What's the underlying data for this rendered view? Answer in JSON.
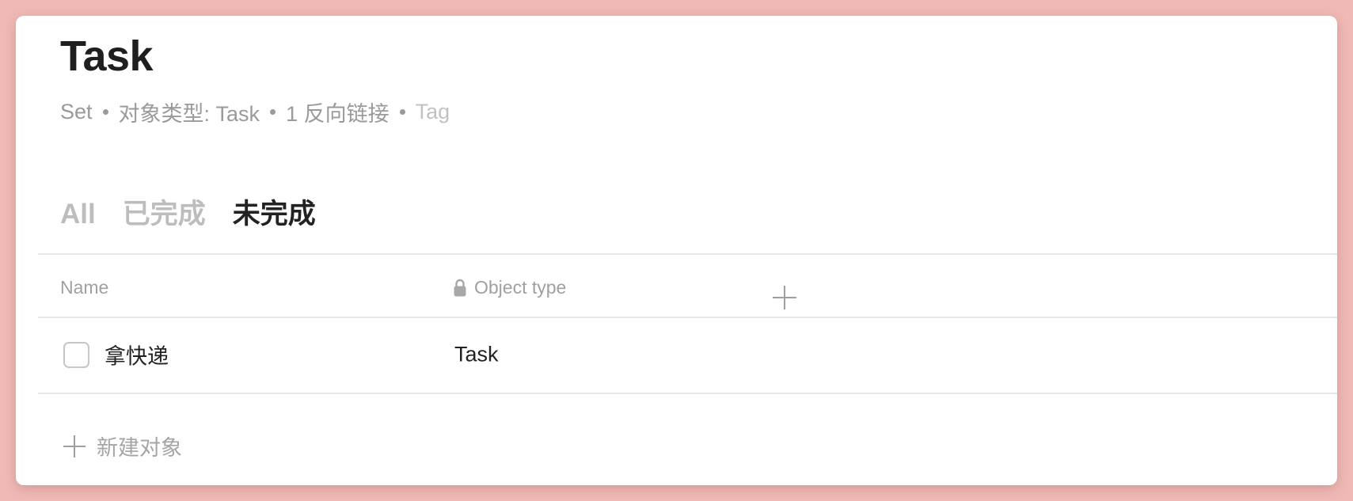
{
  "page": {
    "title": "Task",
    "meta": {
      "set": "Set",
      "object_type": "对象类型: Task",
      "backlinks": "1 反向链接",
      "tag": "Tag"
    }
  },
  "tabs": [
    {
      "label": "All",
      "active": false
    },
    {
      "label": "已完成",
      "active": false
    },
    {
      "label": "未完成",
      "active": true
    }
  ],
  "table": {
    "columns": [
      "Name",
      "Object type"
    ],
    "rows": [
      {
        "name": "拿快递",
        "object_type": "Task",
        "checked": false
      }
    ],
    "add_column_icon": "plus-icon",
    "new_object_label": "新建对象"
  },
  "colors": {
    "background": "#f0b9b5",
    "card": "#ffffff",
    "text_primary": "#222222",
    "text_secondary": "#9a9a9a"
  }
}
